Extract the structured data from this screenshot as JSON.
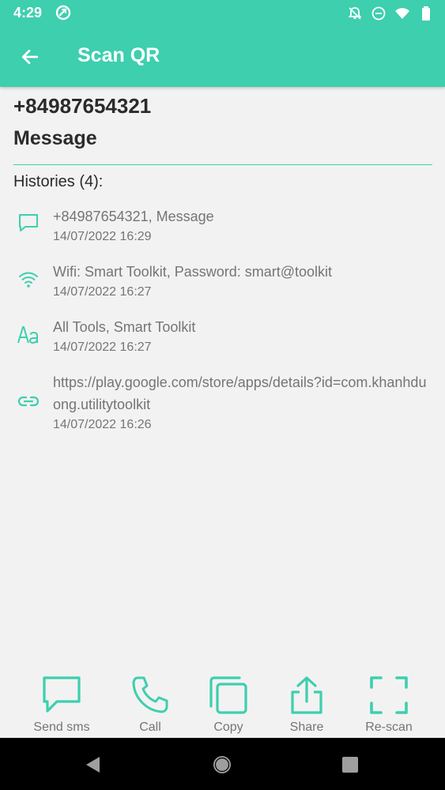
{
  "status_bar": {
    "time": "4:29",
    "icons": [
      "sync-icon",
      "notifications-off-icon",
      "do-not-disturb-icon",
      "wifi-icon",
      "battery-icon"
    ]
  },
  "app_bar": {
    "title": "Scan QR",
    "back_icon": "arrow-left-icon"
  },
  "colors": {
    "accent": "#3dcfae",
    "text_primary": "#2b2b2b",
    "text_secondary": "#757575"
  },
  "result": {
    "line1": "+84987654321",
    "line2": "Message"
  },
  "histories": {
    "heading": "Histories (4):",
    "items": [
      {
        "icon": "message-icon",
        "title": "+84987654321, Message",
        "date": "14/07/2022 16:29"
      },
      {
        "icon": "wifi-icon",
        "title": "Wifi: Smart Toolkit, Password: smart@toolkit",
        "date": "14/07/2022 16:27"
      },
      {
        "icon": "text-aa-icon",
        "title": "All Tools, Smart Toolkit",
        "date": "14/07/2022 16:27"
      },
      {
        "icon": "link-icon",
        "title": "https://play.google.com/store/apps/details?id=com.khanhduong.utilitytoolkit",
        "date": "14/07/2022 16:26"
      }
    ]
  },
  "actions": [
    {
      "icon": "sms-icon",
      "label": "Send sms"
    },
    {
      "icon": "phone-icon",
      "label": "Call"
    },
    {
      "icon": "copy-icon",
      "label": "Copy"
    },
    {
      "icon": "share-icon",
      "label": "Share"
    },
    {
      "icon": "scan-icon",
      "label": "Re-scan"
    }
  ],
  "nav_bar": {
    "icons": [
      "nav-back-icon",
      "nav-home-icon",
      "nav-recents-icon"
    ]
  }
}
